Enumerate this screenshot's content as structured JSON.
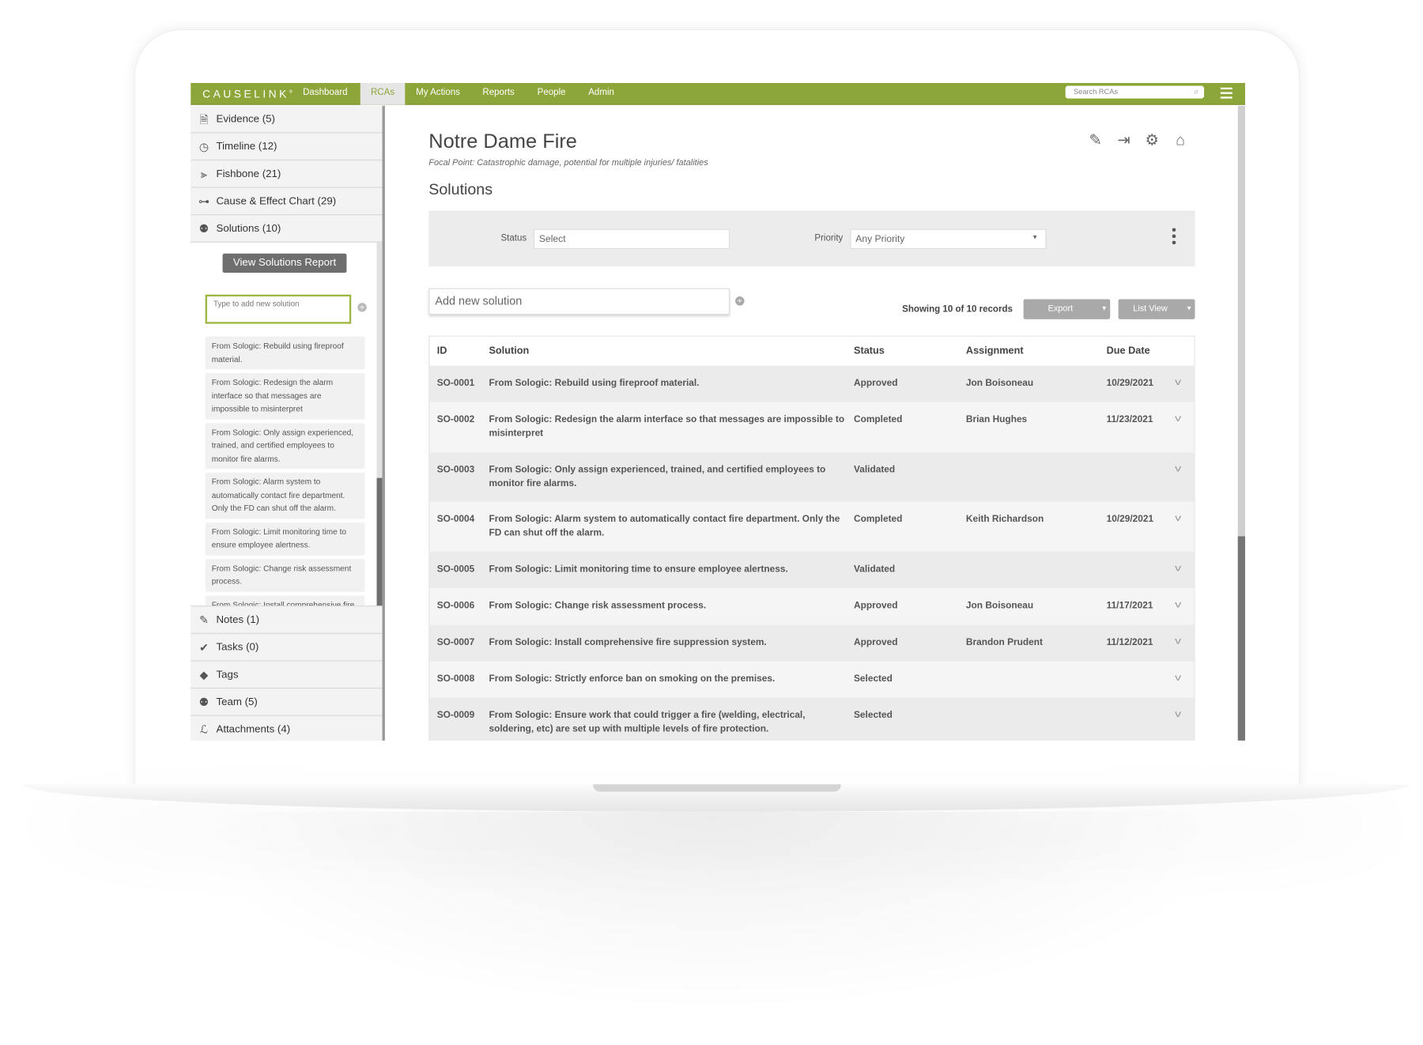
{
  "nav": {
    "logo": "CAUSELINK",
    "items": [
      "Dashboard",
      "RCAs",
      "My Actions",
      "Reports",
      "People",
      "Admin"
    ],
    "active": "RCAs",
    "search_placeholder": "Search RCAs",
    "accent_color": "#8da639"
  },
  "sidebar": {
    "top_items": [
      {
        "label": "Evidence (5)",
        "icon": "document-icon"
      },
      {
        "label": "Timeline (12)",
        "icon": "clock-icon"
      },
      {
        "label": "Fishbone (21)",
        "icon": "fishbone-icon"
      },
      {
        "label": "Cause & Effect Chart (29)",
        "icon": "cause-effect-icon"
      },
      {
        "label": "Solutions (10)",
        "icon": "lightbulb-icon"
      }
    ],
    "view_report_label": "View Solutions Report",
    "new_solution_placeholder": "Type to add new solution",
    "cards": [
      "From Sologic: Rebuild using fireproof material.",
      "From Sologic: Redesign the alarm interface so that messages are impossible to misinterpret",
      "From Sologic: Only assign experienced, trained, and certified employees to monitor fire alarms.",
      "From Sologic: Alarm system to automatically contact fire department. Only the FD can shut off the alarm.",
      "From Sologic: Limit monitoring time to ensure employee alertness.",
      "From Sologic: Change risk assessment process.",
      "From Sologic: Install comprehensive fire"
    ],
    "bottom_items": [
      {
        "label": "Notes (1)",
        "icon": "edit-icon"
      },
      {
        "label": "Tasks (0)",
        "icon": "check-circle-icon"
      },
      {
        "label": "Tags",
        "icon": "tag-icon"
      },
      {
        "label": "Team (5)",
        "icon": "team-icon"
      },
      {
        "label": "Attachments (4)",
        "icon": "paperclip-icon"
      }
    ]
  },
  "main": {
    "title": "Notre Dame Fire",
    "focal_label": "Focal Point:",
    "focal_text": "Catastrophic damage, potential for multiple injuries/ fatalities",
    "section": "Solutions",
    "filters": {
      "status_label": "Status",
      "status_value": "Select",
      "priority_label": "Priority",
      "priority_value": "Any Priority"
    },
    "add_placeholder": "Add new solution",
    "showing": "Showing 10 of 10 records",
    "export_label": "Export",
    "view_label": "List View",
    "columns": [
      "ID",
      "Solution",
      "Status",
      "Assignment",
      "Due Date"
    ],
    "rows": [
      {
        "id": "SO-0001",
        "solution": "From Sologic: Rebuild using fireproof material.",
        "status": "Approved",
        "assignment": "Jon Boisoneau",
        "due": "10/29/2021"
      },
      {
        "id": "SO-0002",
        "solution": "From Sologic: Redesign the alarm interface so that messages are impossible to misinterpret",
        "status": "Completed",
        "assignment": "Brian Hughes",
        "due": "11/23/2021"
      },
      {
        "id": "SO-0003",
        "solution": "From Sologic: Only assign experienced, trained, and certified employees to monitor fire alarms.",
        "status": "Validated",
        "assignment": "",
        "due": ""
      },
      {
        "id": "SO-0004",
        "solution": "From Sologic: Alarm system to automatically contact fire department. Only the FD can shut off the alarm.",
        "status": "Completed",
        "assignment": "Keith Richardson",
        "due": "10/29/2021"
      },
      {
        "id": "SO-0005",
        "solution": "From Sologic: Limit monitoring time to ensure employee alertness.",
        "status": "Validated",
        "assignment": "",
        "due": ""
      },
      {
        "id": "SO-0006",
        "solution": "From Sologic: Change risk assessment process.",
        "status": "Approved",
        "assignment": "Jon Boisoneau",
        "due": "11/17/2021"
      },
      {
        "id": "SO-0007",
        "solution": "From Sologic: Install comprehensive fire suppression system.",
        "status": "Approved",
        "assignment": "Brandon Prudent",
        "due": "11/12/2021"
      },
      {
        "id": "SO-0008",
        "solution": "From Sologic: Strictly enforce ban on smoking on the premises.",
        "status": "Selected",
        "assignment": "",
        "due": ""
      },
      {
        "id": "SO-0009",
        "solution": "From Sologic: Ensure work that could trigger a fire (welding, electrical, soldering, etc) are set up with multiple levels of fire protection.",
        "status": "Selected",
        "assignment": "",
        "due": ""
      }
    ]
  }
}
